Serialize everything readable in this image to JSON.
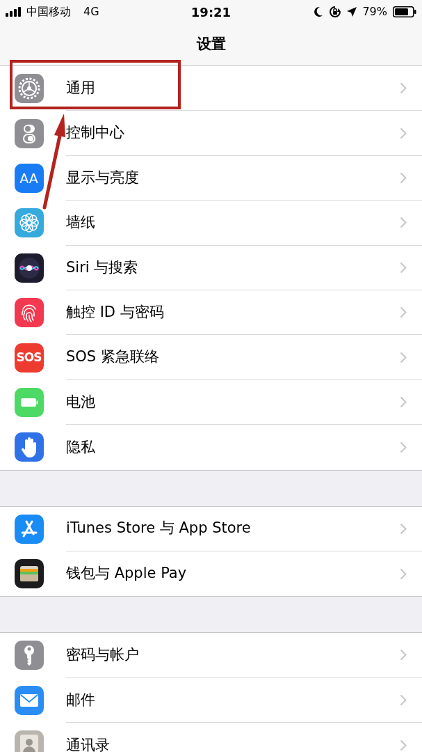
{
  "status_bar": {
    "carrier": "中国移动",
    "network": "4G",
    "time": "19:21",
    "battery": "79%"
  },
  "title": "设置",
  "groups": [
    {
      "rows": [
        {
          "label": "通用",
          "kind": "gear",
          "color": "#8e8e93",
          "highlighted": true
        },
        {
          "label": "控制中心",
          "kind": "toggles",
          "color": "#8e8e93",
          "highlighted": false
        },
        {
          "label": "显示与亮度",
          "kind": "text",
          "icon_text": "AA",
          "color": "#1a7cf5",
          "highlighted": false
        },
        {
          "label": "墙纸",
          "kind": "flower",
          "color": "#36a9dd",
          "highlighted": false
        },
        {
          "label": "Siri 与搜索",
          "kind": "siri",
          "color": "#1c1c2e",
          "highlighted": false
        },
        {
          "label": "触控 ID 与密码",
          "kind": "fingerprint",
          "color": "#f2394f",
          "highlighted": false
        },
        {
          "label": "SOS 紧急联络",
          "kind": "text",
          "icon_text": "SOS",
          "color": "#ee3b30",
          "highlighted": false
        },
        {
          "label": "电池",
          "kind": "battery",
          "color": "#4cd964",
          "highlighted": false
        },
        {
          "label": "隐私",
          "kind": "hand",
          "color": "#2f72e8",
          "highlighted": false
        }
      ]
    },
    {
      "rows": [
        {
          "label": "iTunes Store 与 App Store",
          "kind": "appstore",
          "color": "#1a8cf5",
          "highlighted": false
        },
        {
          "label": "钱包与 Apple Pay",
          "kind": "wallet",
          "color": "#1c1c1e",
          "highlighted": false
        }
      ]
    },
    {
      "rows": [
        {
          "label": "密码与帐户",
          "kind": "key",
          "color": "#8e8e93",
          "highlighted": false
        },
        {
          "label": "邮件",
          "kind": "mail",
          "color": "#2a8df5",
          "highlighted": false
        },
        {
          "label": "通讯录",
          "kind": "contacts",
          "color": "#b9b5ae",
          "highlighted": false
        }
      ]
    }
  ]
}
